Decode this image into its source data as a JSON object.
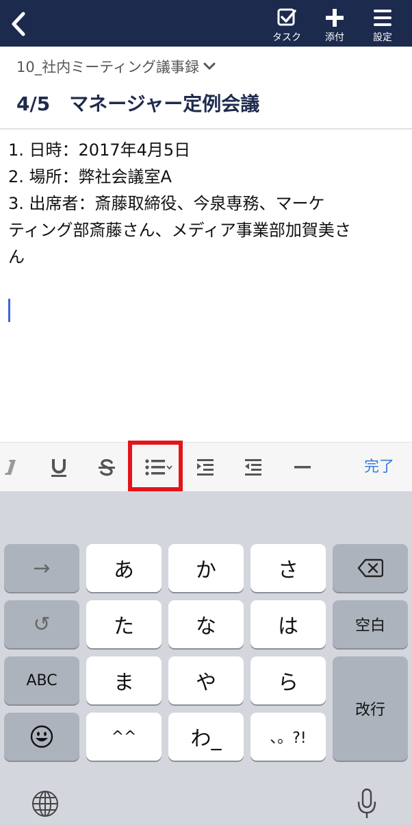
{
  "navbar": {
    "actions": [
      {
        "label": "タスク",
        "icon": "task-check-icon"
      },
      {
        "label": "添付",
        "icon": "plus-icon"
      },
      {
        "label": "設定",
        "icon": "hamburger-menu-icon"
      }
    ]
  },
  "note": {
    "notebook": "10_社内ミーティング議事録",
    "title": "4/5　マネージャー定例会議",
    "lines": [
      "1. 日時：2017年4月5日",
      "2. 場所：弊社会議室A",
      "3. 出席者：斎藤取締役、今泉専務、マーケ",
      "ティング部斎藤さん、メディア事業部加賀美さ",
      "ん"
    ]
  },
  "toolbar": {
    "buttons": [
      "italic-icon",
      "underline-icon",
      "strikethrough-icon",
      "bulleted-list-icon",
      "indent-icon",
      "outdent-icon",
      "horizontal-rule-icon"
    ],
    "done_label": "完了",
    "highlight_color": "#e5141a"
  },
  "keyboard": {
    "row1": [
      "→",
      "あ",
      "か",
      "さ",
      "⌫"
    ],
    "row2": [
      "↺",
      "た",
      "な",
      "は",
      "空白"
    ],
    "row3": [
      "ABC",
      "ま",
      "や",
      "ら",
      "改行"
    ],
    "row4": [
      "😀",
      "^^",
      "わ_",
      "、。?!"
    ]
  },
  "colors": {
    "navbar": "#1c2a4e",
    "accent": "#3a7bdf",
    "title": "#1f2b4d"
  }
}
